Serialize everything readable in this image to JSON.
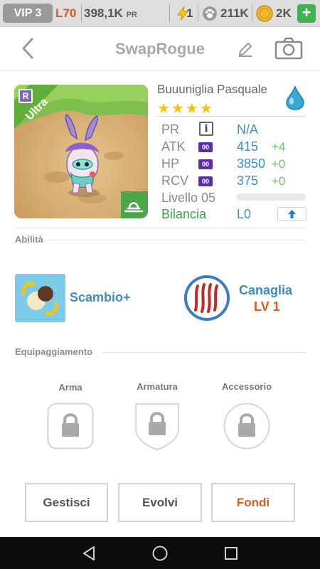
{
  "status_bar": {
    "vip": "VIP 3",
    "level": "L70",
    "pr_value": "398,1K",
    "pr_unit": "PR",
    "energy": "1",
    "paws": "211K",
    "coins": "2K",
    "add": "+"
  },
  "header": {
    "title": "SwapRogue"
  },
  "monster": {
    "rarity_letter": "R",
    "rarity": "Ultra",
    "name": "Buuuniglia Pasquale",
    "stars": "★★★★",
    "stats": [
      {
        "label": "PR",
        "value": "N/A",
        "bonus": ""
      },
      {
        "label": "ATK",
        "badge": "00",
        "value": "415",
        "bonus": "+4"
      },
      {
        "label": "HP",
        "badge": "00",
        "value": "3850",
        "bonus": "+0"
      },
      {
        "label": "RCV",
        "badge": "00",
        "value": "375",
        "bonus": "+0"
      }
    ],
    "level_label": "Livello 05",
    "level_progress": 0.0,
    "balance_label": "Bilancia",
    "balance_value": "L0",
    "colors": {
      "balance": "#3aa64b",
      "value": "#3b8fd6",
      "bonus": "#66c466",
      "ultra": "#5fae3a"
    }
  },
  "abilities": {
    "section_title": "Abilità",
    "skill": {
      "name": "Scambio+"
    },
    "leader": {
      "name": "Canaglia",
      "level": "LV 1"
    }
  },
  "equipment": {
    "section_title": "Equipaggiamento",
    "slots": [
      {
        "label": "Arma"
      },
      {
        "label": "Armatura"
      },
      {
        "label": "Accessorio"
      }
    ]
  },
  "actions": {
    "manage": "Gestisci",
    "evolve": "Evolvi",
    "merge": "Fondi"
  }
}
